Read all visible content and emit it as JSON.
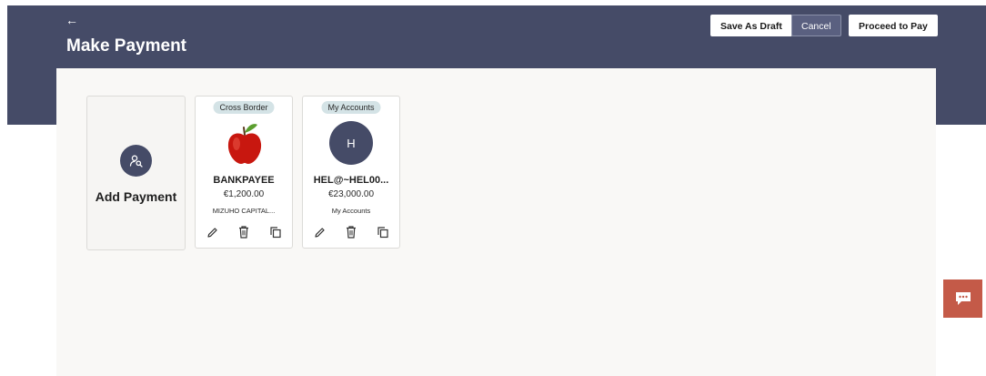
{
  "header": {
    "back_icon": "left-arrow-icon",
    "title": "Make Payment",
    "save_draft_label": "Save As Draft",
    "cancel_label": "Cancel",
    "proceed_label": "Proceed to Pay"
  },
  "add_payment": {
    "label": "Add Payment",
    "icon": "user-search-icon"
  },
  "payees": [
    {
      "tag": "Cross Border",
      "image": "apple-image",
      "name": "BANKPAYEE",
      "amount": "€1,200.00",
      "sub": "MIZUHO CAPITAL..."
    },
    {
      "tag": "My Accounts",
      "avatar_initial": "H",
      "name": "HEL@~HEL00...",
      "amount": "€23,000.00",
      "sub": "My Accounts"
    }
  ],
  "card_actions": [
    "edit-icon",
    "delete-icon",
    "copy-icon"
  ],
  "chat": {
    "icon": "chat-icon"
  },
  "colors": {
    "header_bg": "#454b67",
    "panel_bg": "#f9f8f6",
    "tag_bg": "#d4e3e6",
    "chat_bg": "#c45a48"
  }
}
